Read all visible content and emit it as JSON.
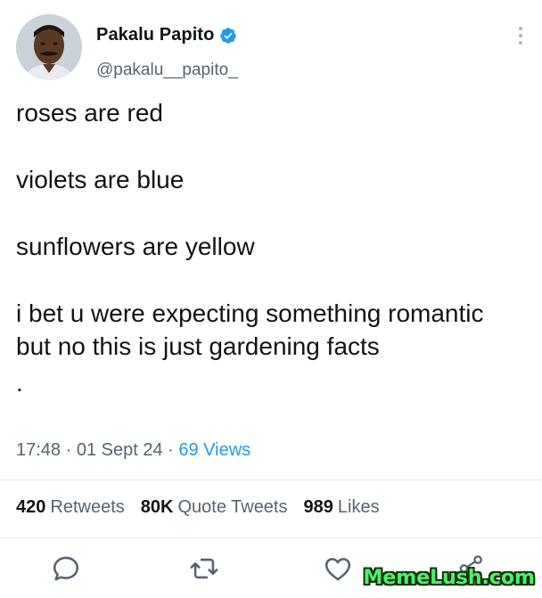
{
  "profile": {
    "display_name": "Pakalu Papito",
    "handle": "@pakalu__papito_",
    "verified": true
  },
  "tweet": {
    "lines": [
      "roses are red",
      "violets are blue",
      "sunflowers are yellow",
      "i bet u were expecting something romantic but no this is just gardening facts",
      "."
    ]
  },
  "meta": {
    "time": "17:48",
    "date": "01 Sept 24",
    "views": "69 Views"
  },
  "stats": {
    "retweets_count": "420",
    "retweets_label": "Retweets",
    "quotes_count": "80K",
    "quotes_label": "Quote Tweets",
    "likes_count": "989",
    "likes_label": "Likes"
  },
  "icons": {
    "verified": "verified-badge-icon",
    "more": "more-options-icon",
    "reply": "reply-icon",
    "retweet": "retweet-icon",
    "like": "like-icon",
    "share": "share-icon"
  },
  "colors": {
    "accent": "#1d9bf0",
    "secondary_text": "#536471",
    "watermark": "#4ef06b"
  },
  "watermark": "MemeLush.com"
}
